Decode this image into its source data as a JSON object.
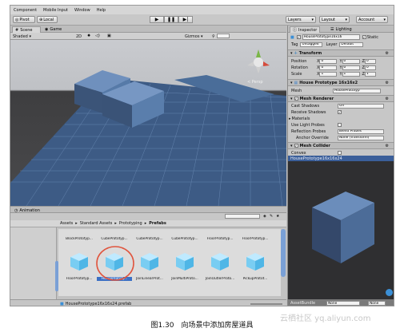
{
  "menubar": [
    "Component",
    "Mobile Input",
    "Window",
    "Help"
  ],
  "toolbar": {
    "pivot": "Pivot",
    "local": "Local",
    "layers": "Layers",
    "layout": "Layout",
    "account": "Account"
  },
  "scene": {
    "tab_scene": "Scene",
    "tab_game": "Game",
    "shading": "Shaded",
    "mode_2d": "2D",
    "gizmos": "Gizmos",
    "persp": "< Persp"
  },
  "animation": {
    "tab": "Animation"
  },
  "project": {
    "breadcrumb": [
      "Assets",
      "Standard Assets",
      "Prototyping",
      "Prefabs"
    ],
    "row1": [
      "BlockPrototyp...",
      "CubePrototyp...",
      "CubePrototyp...",
      "CubePrototyp...",
      "FloorPrototyp...",
      "FloorPrototyp..."
    ],
    "row2": [
      "FloorPrototyp...",
      "HousePrototy...",
      "JoinLinearProt...",
      "JoinMultiProto...",
      "JoinOutlerProto...",
      "PickupProtot..."
    ],
    "selected_index": 1,
    "status": "HousePrototype16x16x24.prefab"
  },
  "inspector": {
    "tab_inspector": "Inspector",
    "tab_lighting": "Lighting",
    "object_name": "HousePrototype16x16",
    "static": "Static",
    "tag_label": "Tag",
    "tag_value": "Untagged",
    "layer_label": "Layer",
    "layer_value": "Default",
    "transform": {
      "title": "Transform",
      "position": {
        "label": "Position",
        "x": "0",
        "y": "0",
        "z": "0"
      },
      "rotation": {
        "label": "Rotation",
        "x": "0",
        "y": "0",
        "z": "0"
      },
      "scale": {
        "label": "Scale",
        "x": "1",
        "y": "1",
        "z": "1"
      }
    },
    "mesh_filter": {
      "title": "House Prototype 16x16x2",
      "mesh_label": "Mesh",
      "mesh_value": "HousePrototyp"
    },
    "mesh_renderer": {
      "title": "Mesh Renderer",
      "cast_shadows": {
        "label": "Cast Shadows",
        "value": "Off"
      },
      "receive_shadows": "Receive Shadows",
      "materials": "Materials",
      "light_probes": "Use Light Probes",
      "reflection_probes": {
        "label": "Reflection Probes",
        "value": "Blend Probes"
      },
      "anchor_override": {
        "label": "Anchor Override",
        "value": "None (Transform)"
      }
    },
    "mesh_collider": {
      "title": "Mesh Collider",
      "convex": "Convex"
    },
    "preview_title": "HousePrototype16x16x24",
    "assetbundle_label": "AssetBundle",
    "assetbundle_value": "None",
    "assetbundle_variant": "None"
  },
  "caption": "图1.30　向场景中添加房屋道具",
  "watermark": "云栖社区 yq.aliyun.com",
  "colors": {
    "selection": "#3b6fc4",
    "sky": "#c6c8cc",
    "ground": "#444446",
    "floor_plane": "#3f5f8a",
    "house": "#4b6a94",
    "cube_icon": "#7fd0f2",
    "highlight_circle": "#e0553e"
  }
}
